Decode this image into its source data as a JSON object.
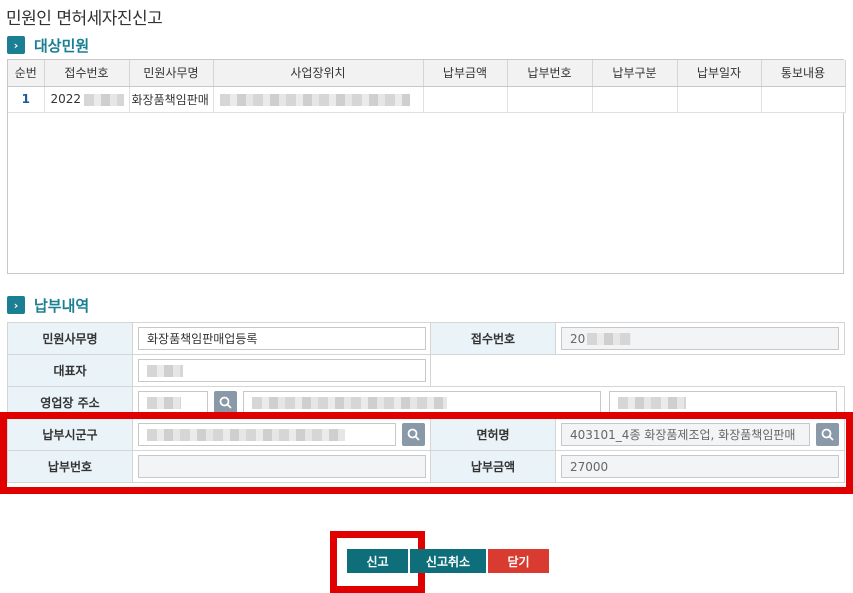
{
  "page": {
    "title": "민원인 면허세자진신고"
  },
  "section1": {
    "title": "대상민원"
  },
  "grid": {
    "headers": [
      "순번",
      "접수번호",
      "민원사무명",
      "사업장위치",
      "납부금액",
      "납부번호",
      "납부구분",
      "납부일자",
      "통보내용"
    ],
    "row": {
      "num": "1",
      "receipt": "2022",
      "service": "화장품책임판매"
    }
  },
  "section2": {
    "title": "납부내역"
  },
  "form": {
    "service_label": "민원사무명",
    "service_value": "화장품책임판매업등록",
    "receipt_label": "접수번호",
    "receipt_value": "20",
    "rep_label": "대표자",
    "addr_label": "영업장 주소",
    "city_label": "납부시군구",
    "license_label": "면허명",
    "license_value": "403101_4종 화장품제조업, 화장품책임판매",
    "paynum_label": "납부번호",
    "amount_label": "납부금액",
    "amount_value": "27000"
  },
  "buttons": {
    "submit": "신고",
    "cancel_report": "신고취소",
    "close": "닫기"
  },
  "icons": {
    "search": "search-icon",
    "chevron": "chevron-right-icon"
  },
  "colors": {
    "accent": "#1a7f93",
    "highlight": "#e00000",
    "close_button": "#d93b30"
  }
}
